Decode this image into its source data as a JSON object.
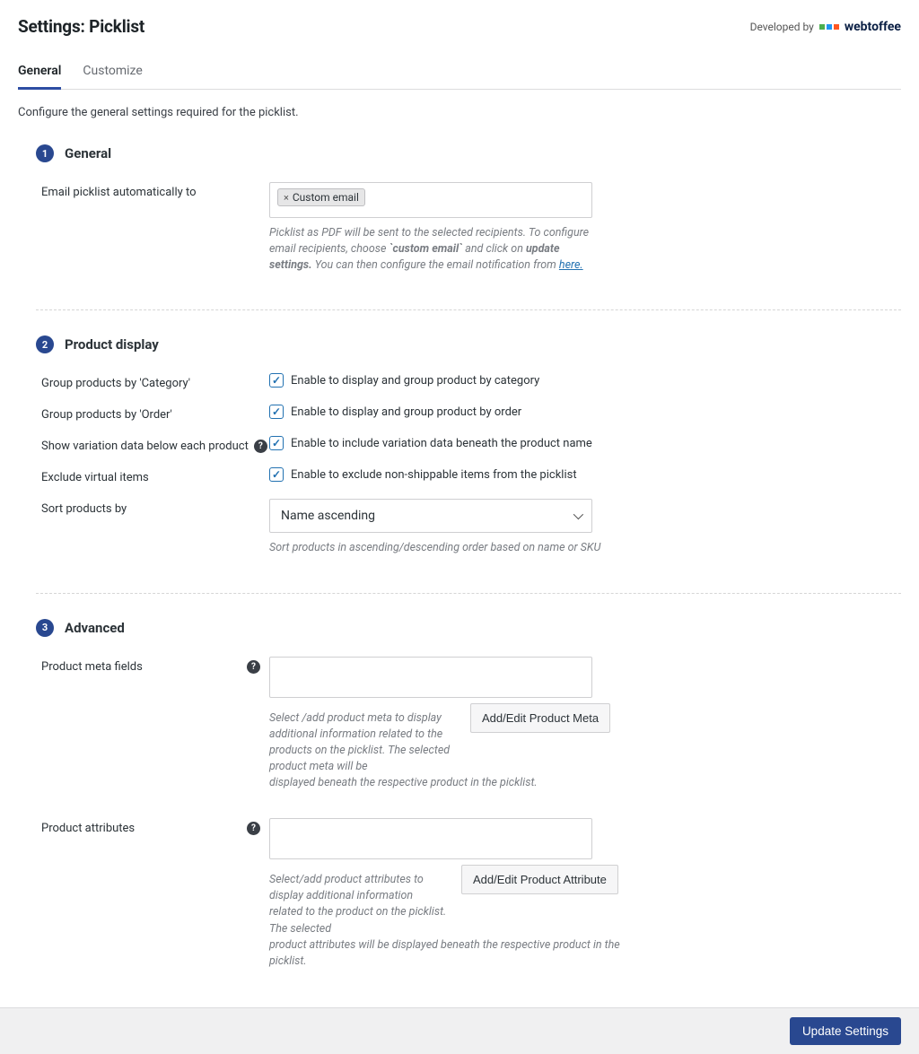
{
  "header": {
    "title": "Settings: Picklist",
    "developed_by": "Developed by",
    "brand": "webtoffee"
  },
  "tabs": [
    {
      "label": "General",
      "active": true
    },
    {
      "label": "Customize",
      "active": false
    }
  ],
  "intro": "Configure the general settings required for the picklist.",
  "sections": {
    "general": {
      "num": "1",
      "title": "General",
      "email_label": "Email picklist automatically to",
      "email_tag": "Custom email",
      "email_help_1": "Picklist as PDF will be sent to the selected recipients. To configure email recipients, choose ",
      "email_help_code": "`custom email`",
      "email_help_2": " and click on ",
      "email_help_bold": "update settings.",
      "email_help_3": " You can then configure the email notification from ",
      "email_help_link": "here."
    },
    "product_display": {
      "num": "2",
      "title": "Product display",
      "group_category_label": "Group products by 'Category'",
      "group_category_desc": "Enable to display and group product by category",
      "group_order_label": "Group products by 'Order'",
      "group_order_desc": "Enable to display and group product by order",
      "variation_label": "Show variation data below each product",
      "variation_desc": "Enable to include variation data beneath the product name",
      "exclude_label": "Exclude virtual items",
      "exclude_desc": "Enable to exclude non-shippable items from the picklist",
      "sort_label": "Sort products by",
      "sort_value": "Name ascending",
      "sort_help": "Sort products in ascending/descending order based on name or SKU"
    },
    "advanced": {
      "num": "3",
      "title": "Advanced",
      "meta_label": "Product meta fields",
      "meta_help": "Select /add product meta to display additional information related to the products on the picklist. The selected product meta will be displayed beneath the respective product in the picklist.",
      "meta_button": "Add/Edit Product Meta",
      "attr_label": "Product attributes",
      "attr_help": "Select/add product attributes to display additional information related to the product on the picklist. The selected product attributes will be displayed beneath the respective product in the picklist.",
      "attr_button": "Add/Edit Product Attribute"
    }
  },
  "footer": {
    "update": "Update Settings"
  }
}
